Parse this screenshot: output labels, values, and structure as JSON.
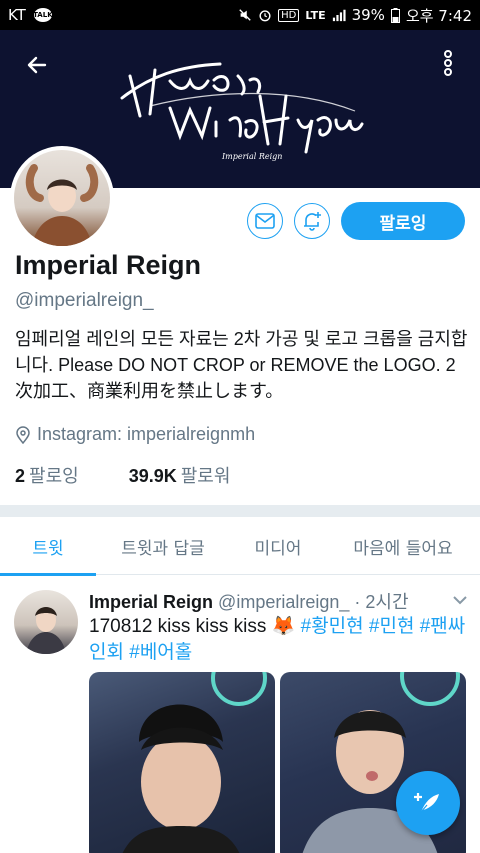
{
  "status_bar": {
    "carrier": "KT",
    "talk_badge": "TALK",
    "network": "LTE",
    "hd": "HD",
    "battery": "39%",
    "time": "오후 7:42"
  },
  "banner": {
    "logo_caption": "Imperial Reign",
    "logo_image_text": "Hwang Min Hyun",
    "background_color": "#0d1230"
  },
  "profile": {
    "name": "Imperial Reign",
    "handle": "@imperialreign_",
    "follow_label": "팔로잉",
    "bio": "임페리얼 레인의 모든 자료는 2차 가공 및 로고 크롭을 금지합니다. Please DO NOT CROP or REMOVE the LOGO. 2次加工、商業利用を禁止します。",
    "location": "Instagram: imperialreignmh",
    "following_count": "2",
    "following_label": "팔로잉",
    "followers_count": "39.9K",
    "followers_label": "팔로워"
  },
  "tabs": [
    {
      "label": "트윗",
      "active": true
    },
    {
      "label": "트윗과 답글",
      "active": false
    },
    {
      "label": "미디어",
      "active": false
    },
    {
      "label": "마음에 들어요",
      "active": false
    }
  ],
  "tweet": {
    "author": "Imperial Reign",
    "handle": "@imperialreign_",
    "separator": "·",
    "time": "2시간",
    "text_prefix": "170812 kiss kiss kiss 🦊 ",
    "hashtags": [
      "#황민현",
      "#민현",
      "#팬싸인회",
      "#베어홀"
    ]
  },
  "colors": {
    "accent": "#1da1f2",
    "secondary_text": "#657786"
  }
}
